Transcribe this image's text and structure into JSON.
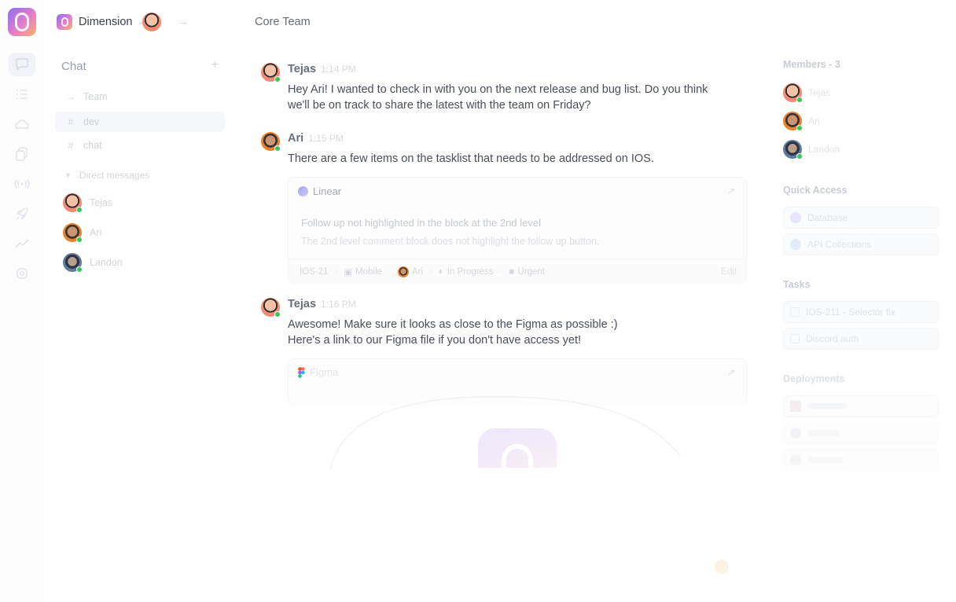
{
  "rail": {
    "icons": [
      "chat-icon",
      "list-icon",
      "cloud-icon",
      "documents-icon",
      "broadcast-icon",
      "rocket-icon",
      "analytics-icon",
      "settings-icon"
    ]
  },
  "workspace": {
    "name": "Dimension"
  },
  "sidebar": {
    "title": "Chat",
    "items": [
      {
        "label": "Team",
        "icon": "arrow-icon"
      },
      {
        "label": "dev",
        "icon": "hash-icon"
      },
      {
        "label": "chat",
        "icon": "hash-icon"
      }
    ],
    "dm_header": "Direct messages",
    "direct_messages": [
      {
        "name": "Tejas"
      },
      {
        "name": "Ari"
      },
      {
        "name": "Landon"
      }
    ]
  },
  "channel": {
    "title": "Core Team"
  },
  "messages": [
    {
      "author": "Tejas",
      "time": "1:14 PM",
      "lines": [
        "Hey Ari! I wanted to check in with you on the next release and bug list. Do you think",
        "we'll be on track to share the latest with the team on Friday?"
      ]
    },
    {
      "author": "Ari",
      "time": "1:15 PM",
      "lines": [
        "There are a few items on the tasklist that needs to be addressed on IOS."
      ]
    },
    {
      "author": "Tejas",
      "time": "1:16 PM",
      "lines": [
        "Awesome! Make sure it looks as close to the Figma as possible :)",
        "Here's a link to our Figma file if you don't have access yet!"
      ]
    }
  ],
  "linear_card": {
    "source": "Linear",
    "title": "Follow up not highlighted in the block at the 2nd level",
    "description": "The 2nd level comment block does not highlight the follow up button.",
    "issue_id": "IOS-21",
    "team": "Mobile",
    "assignee": "Ari",
    "status": "In Progress",
    "priority": "Urgent",
    "edit_label": "Edit"
  },
  "figma_card": {
    "source": "Figma"
  },
  "right_panel": {
    "members_title": "Members - 3",
    "members": [
      "Tejas",
      "Ari",
      "Landon"
    ],
    "quick_access_title": "Quick Access",
    "quick_access": [
      "Database",
      "API Collections"
    ],
    "tasks_title": "Tasks",
    "tasks": [
      "IOS-211 - Selector fix",
      "Discord auth"
    ],
    "deployments_title": "Deployments",
    "deployments": [
      "",
      "",
      ""
    ]
  },
  "colors": {
    "accent_gradient_start": "#8b6cf6",
    "accent_gradient_mid": "#e67ec8",
    "accent_gradient_end": "#f7b267",
    "online": "#34c759"
  }
}
